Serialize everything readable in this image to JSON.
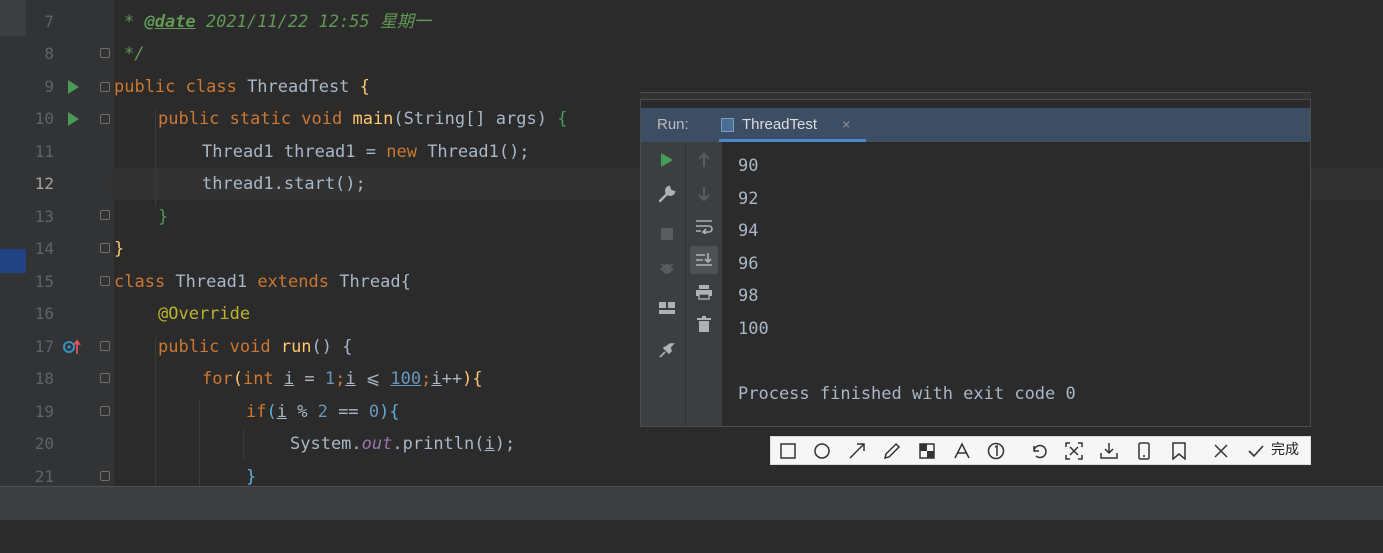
{
  "editor": {
    "lines": [
      {
        "num": "7"
      },
      {
        "num": "8"
      },
      {
        "num": "9"
      },
      {
        "num": "10"
      },
      {
        "num": "11"
      },
      {
        "num": "12"
      },
      {
        "num": "13"
      },
      {
        "num": "14"
      },
      {
        "num": "15"
      },
      {
        "num": "16"
      },
      {
        "num": "17"
      },
      {
        "num": "18"
      },
      {
        "num": "19"
      },
      {
        "num": "20"
      },
      {
        "num": "21"
      }
    ],
    "code": {
      "l7_star": "* ",
      "l7_tag": "@date",
      "l7_text": " 2021/11/22 12:55 星期一",
      "l8": "*/",
      "l9_kw": "public class",
      "l9_name": " ThreadTest ",
      "l9_brace": "{",
      "l10_kw": "public static void",
      "l10_fn": " main",
      "l10_args": "(String[] args) ",
      "l10_brace": "{",
      "l11_a": "Thread1 thread1 = ",
      "l11_kw": "new",
      "l11_b": " Thread1();",
      "l12": "thread1.start();",
      "l13": "}",
      "l14": "}",
      "l15_kw1": "class",
      "l15_name": " Thread1 ",
      "l15_kw2": "extends",
      "l15_rest": " Thread{",
      "l16": "@Override",
      "l17_kw": "public void",
      "l17_fn": " run",
      "l17_rest": "() {",
      "l18_kw": "for",
      "l18_p": "(",
      "l18_int": "int",
      "l18_i": "i",
      "l18_eq": " = ",
      "l18_1": "1",
      "l18_semi": ";",
      "l18_i2": "i",
      "l18_le": " ⩽ ",
      "l18_100": "100",
      "l18_semi2": ";",
      "l18_i3": "i",
      "l18_pp": "++",
      "l18_end": "){",
      "l19_kw": "if",
      "l19_p": "(",
      "l19_i": "i",
      "l19_mod": " % ",
      "l19_2": "2",
      "l19_eq": " == ",
      "l19_0": "0",
      "l19_end": "){",
      "l20_a": "System.",
      "l20_out": "out",
      "l20_b": ".println(",
      "l20_i": "i",
      "l20_c": ");",
      "l21": "}"
    }
  },
  "run": {
    "label": "Run:",
    "tab_label": "ThreadTest",
    "tab_close": "×",
    "output": [
      "90",
      "92",
      "94",
      "96",
      "98",
      "100",
      "",
      "Process finished with exit code 0"
    ]
  },
  "snip": {
    "done_label": "完成"
  },
  "colors": {
    "accent": "#4a88c7",
    "run_green": "#499c54"
  }
}
